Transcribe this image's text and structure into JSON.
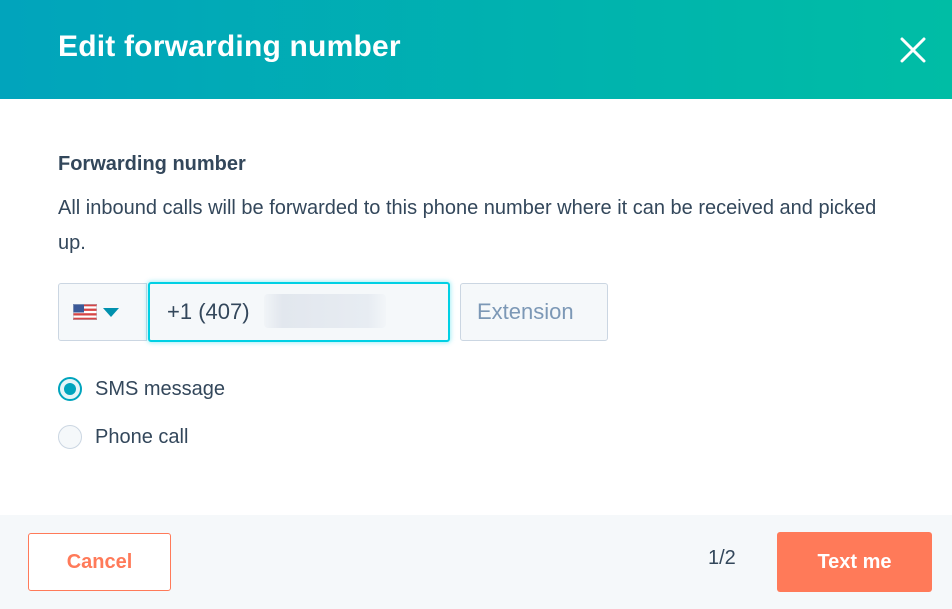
{
  "modal": {
    "title": "Edit forwarding number",
    "close_icon": "close-icon",
    "header_gradient": [
      "#01a4bc",
      "#00bda5"
    ]
  },
  "form": {
    "section_label": "Forwarding number",
    "description": "All inbound calls will be forwarded to this phone number where it can be received and picked up.",
    "country": {
      "flag_icon": "us-flag-icon",
      "caret_icon": "caret-down-icon"
    },
    "phone": {
      "value": "+1 (407)"
    },
    "extension": {
      "value": "",
      "placeholder": "Extension"
    },
    "verification_methods": [
      {
        "label": "SMS message",
        "selected": true
      },
      {
        "label": "Phone call",
        "selected": false
      }
    ]
  },
  "footer": {
    "cancel_label": "Cancel",
    "pager": "1/2",
    "primary_label": "Text me"
  },
  "colors": {
    "accent": "#00a4bd",
    "focus_border": "#00d0e4",
    "primary_button": "#ff7a59",
    "text": "#33475b",
    "footer_bg": "#f5f8fa"
  }
}
